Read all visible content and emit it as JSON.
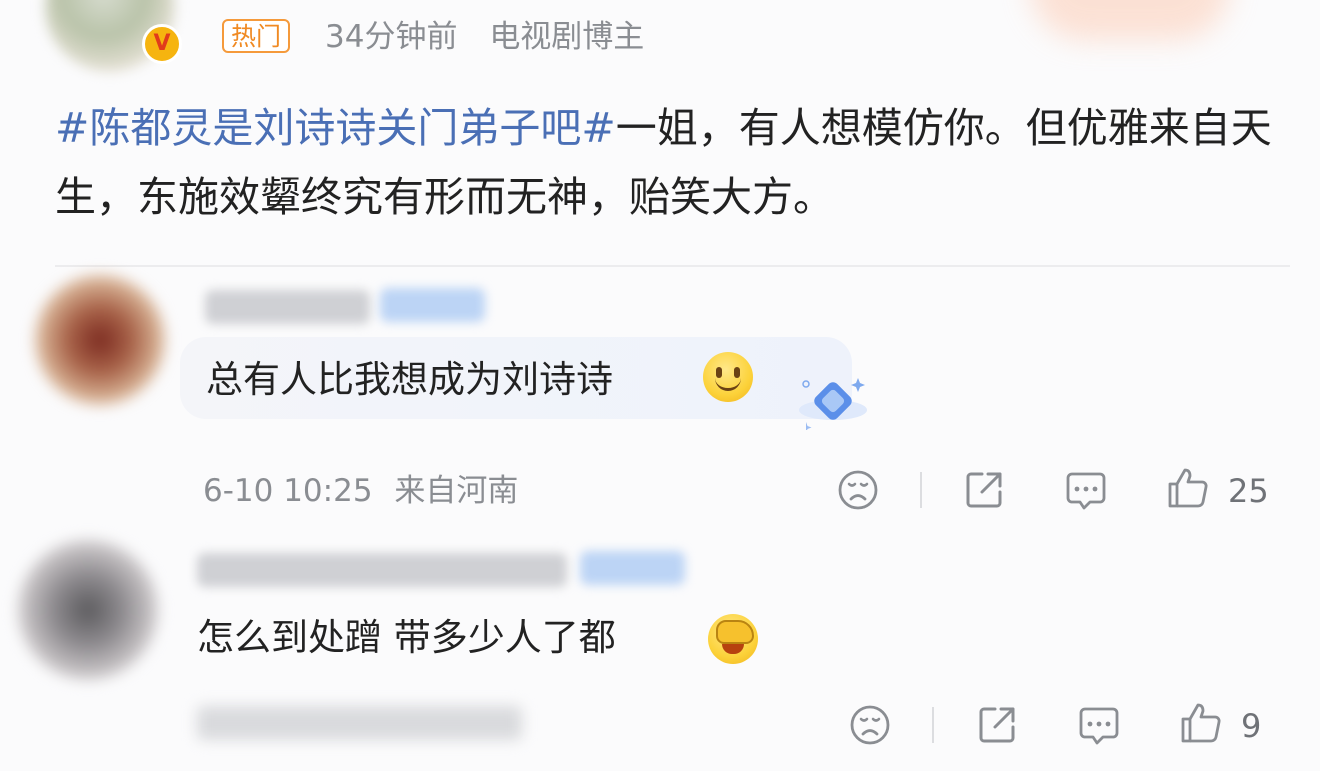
{
  "post": {
    "tag": "热门",
    "time": "34分钟前",
    "source": "电视剧博主",
    "hashtag": "#陈都灵是刘诗诗关门弟子吧#",
    "text": "一姐，有人想模仿你。但优雅来自天生，东施效颦终究有形而无神，贻笑大方。"
  },
  "comments": [
    {
      "text": "总有人比我想成为刘诗诗",
      "emoji": "smile-emoji",
      "date": "6-10 10:25",
      "location": "来自河南",
      "likes": "25"
    },
    {
      "text": "怎么到处蹭 带多少人了都",
      "emoji": "facepalm-emoji",
      "likes": "9"
    }
  ],
  "icons": [
    "dislike-icon",
    "share-icon",
    "reply-icon",
    "like-icon"
  ],
  "colors": {
    "hashtag": "#4a6fb5",
    "hot_tag": "#f08a23",
    "meta_text": "#8a8d92"
  }
}
